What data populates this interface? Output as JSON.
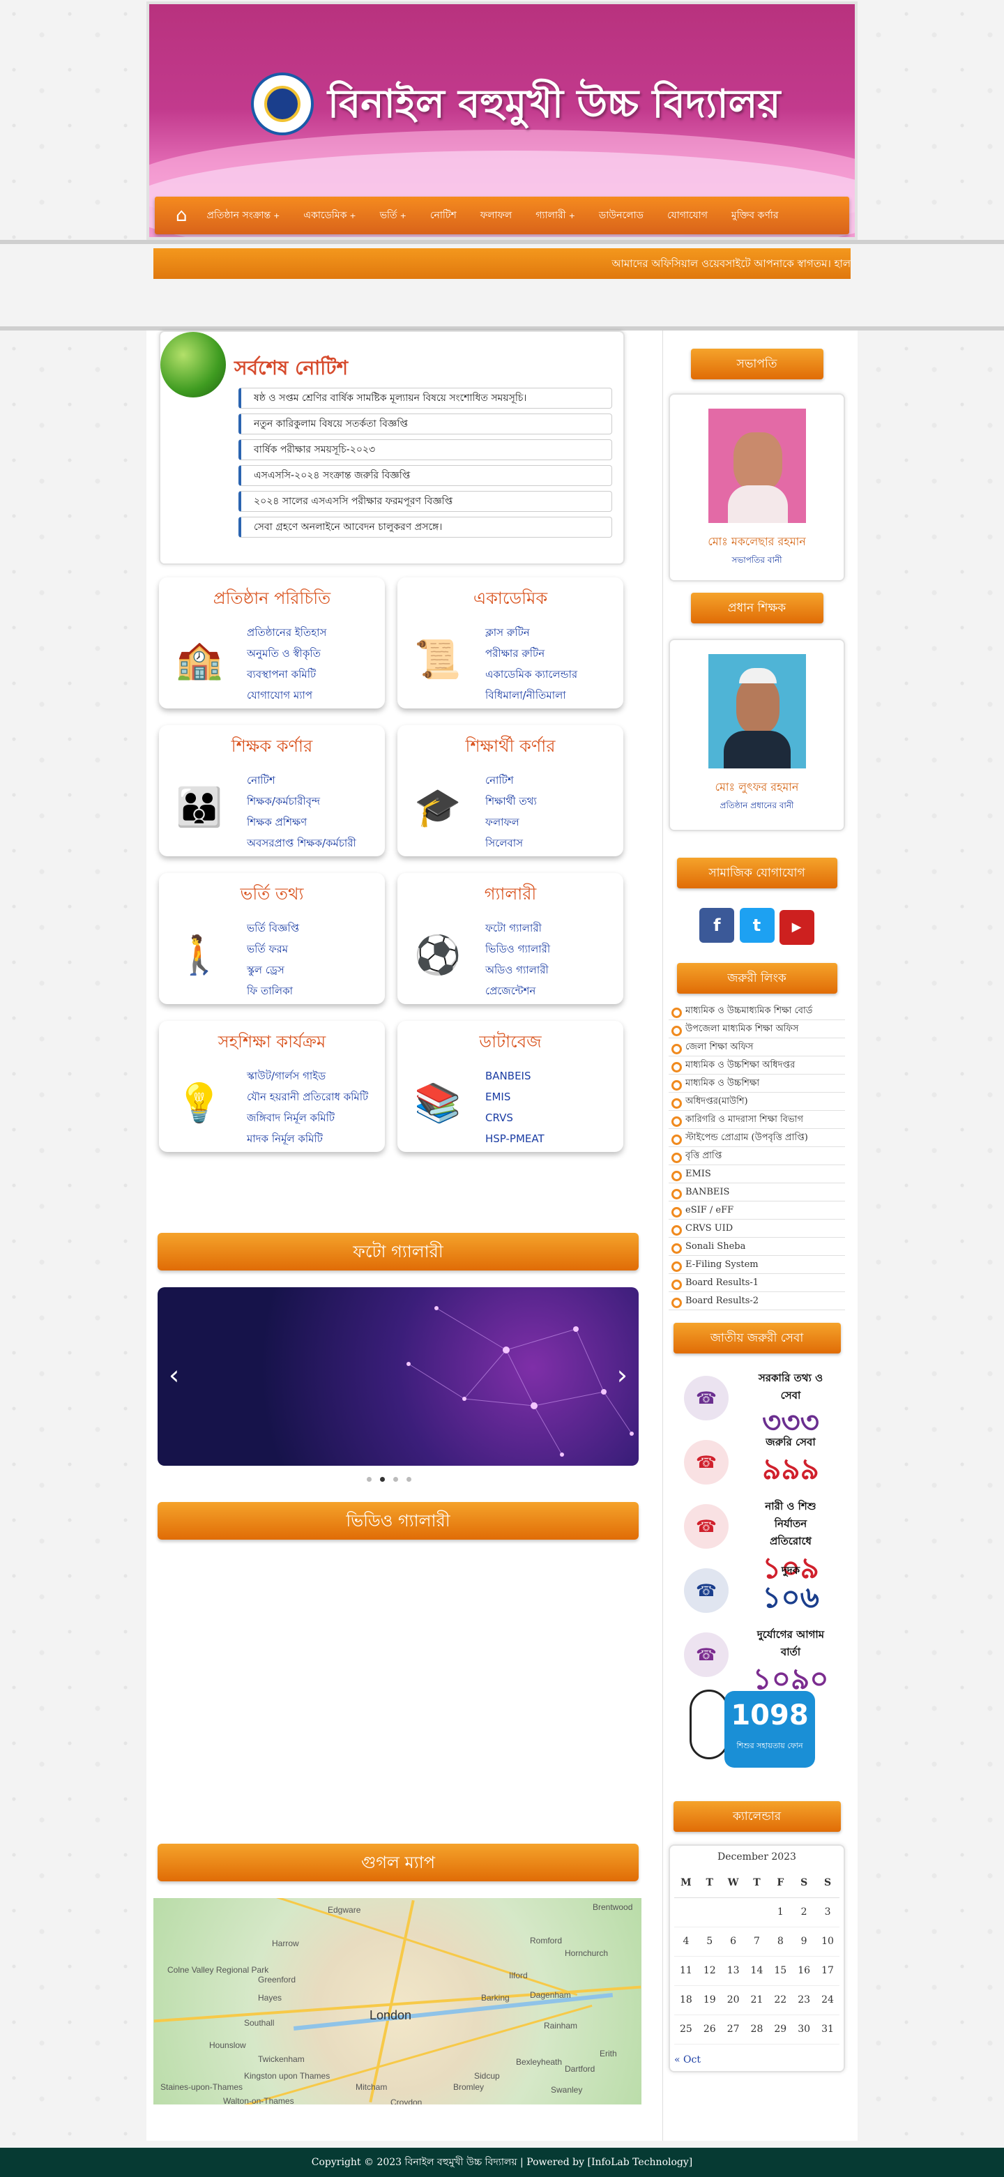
{
  "site": {
    "title": "বিনাইল বহুমুখী উচ্চ বিদ্যালয়"
  },
  "nav": {
    "items": [
      {
        "label": "প্রতিষ্ঠান সংক্রান্ত",
        "dropdown": true
      },
      {
        "label": "একাডেমিক",
        "dropdown": true
      },
      {
        "label": "ভর্তি",
        "dropdown": true
      },
      {
        "label": "নোটিশ",
        "dropdown": false
      },
      {
        "label": "ফলাফল",
        "dropdown": false
      },
      {
        "label": "গ্যালারী",
        "dropdown": true
      },
      {
        "label": "ডাউনলোড",
        "dropdown": false
      },
      {
        "label": "যোগাযোগ",
        "dropdown": false
      },
      {
        "label": "মুক্তিব কর্ণার",
        "dropdown": false
      }
    ]
  },
  "marquee": {
    "text": "আমাদের অফিসিয়াল ওয়েবসাইটে আপনাকে স্বাগতম। হাল"
  },
  "notices": {
    "title": "সর্বশেষ নোটিশ",
    "items": [
      "ষষ্ঠ ও সপ্তম শ্রেণির বার্ষিক সামষ্টিক মূল্যায়ন বিষয়ে সংশোধিত সময়সূচি।",
      "নতুন কারিকুলাম বিষয়ে সতর্কতা বিজ্ঞপ্তি",
      "বার্ষিক পরীক্ষার সময়সূচি-২০২৩",
      "এসএসসি-২০২৪ সংক্রান্ত জরুরি বিজ্ঞপ্তি",
      "২০২৪ সালের এসএসসি পরীক্ষার ফরমপূরণ বিজ্ঞপ্তি",
      "সেবা গ্রহণে অনলাইনে আবেদন চালুকরণ প্রসঙ্গে।"
    ]
  },
  "cards": [
    {
      "title": "প্রতিষ্ঠান পরিচিতি",
      "icon": "school-building-icon",
      "links": [
        "প্রতিষ্ঠানের ইতিহাস",
        "অনুমতি ও স্বীকৃতি",
        "ব্যবস্থাপনা কমিটি",
        "যোগাযোগ ম্যাপ"
      ]
    },
    {
      "title": "একাডেমিক",
      "icon": "certificate-icon",
      "links": [
        "ক্লাস রুটিন",
        "পরীক্ষার রুটিন",
        "একাডেমিক ক্যালেন্ডার",
        "বিধিমালা/নীতিমালা"
      ]
    },
    {
      "title": "শিক্ষক কর্ণার",
      "icon": "teachers-group-icon",
      "links": [
        "নোটিশ",
        "শিক্ষক/কর্মচারীবৃন্দ",
        "শিক্ষক প্রশিক্ষণ",
        "অবসরপ্রাপ্ত শিক্ষক/কর্মচারী"
      ]
    },
    {
      "title": "শিক্ষার্থী কর্ণার",
      "icon": "graduate-icon",
      "links": [
        "নোটিশ",
        "শিক্ষার্থী তথ্য",
        "ফলাফল",
        "সিলেবাস"
      ]
    },
    {
      "title": "ভর্তি তথ্য",
      "icon": "student-walking-icon",
      "links": [
        "ভর্তি বিজ্ঞপ্তি",
        "ভর্তি ফরম",
        "স্কুল ড্রেস",
        "ফি তালিকা"
      ]
    },
    {
      "title": "গ্যালারী",
      "icon": "sports-balls-icon",
      "links": [
        "ফটো গ্যালারী",
        "ভিডিও গ্যালারী",
        "অডিও গ্যালারী",
        "প্রেজেন্টেশন"
      ]
    },
    {
      "title": "সহশিক্ষা কার্যক্রম",
      "icon": "lightbulb-gear-icon",
      "links": [
        "স্কাউট/গার্লস গাইড",
        "যৌন হয়রানী প্রতিরোধ কমিটি",
        "জঙ্গিবাদ নির্মূল কমিটি",
        "মাদক নির্মূল কমিটি"
      ]
    },
    {
      "title": "ডাটাবেজ",
      "icon": "database-books-icon",
      "links": [
        "BANBEIS",
        "EMIS",
        "CRVS",
        "HSP-PMEAT"
      ]
    }
  ],
  "sections": {
    "photo_gallery": "ফটো গ্যালারী",
    "video_gallery": "ভিডিও গ্যালারী",
    "google_map": "গুগল ম্যাপ"
  },
  "map": {
    "labels": [
      "Edgware",
      "Brentwood",
      "Harrow",
      "Romford",
      "Hornchurch",
      "Colne Valley Regional Park",
      "Greenford",
      "Ilford",
      "Barking",
      "Dagenham",
      "Hayes",
      "Southall",
      "London",
      "Rainham",
      "Hounslow",
      "Twickenham",
      "Erith",
      "Bexleyheath",
      "Dartford",
      "Kingston upon Thames",
      "Sidcup",
      "Staines-upon-Thames",
      "Mitcham",
      "Bromley",
      "Swanley",
      "Walton-on-Thames",
      "Croydon"
    ]
  },
  "sidebar": {
    "chairman": {
      "header": "সভাপতি",
      "name": "মোঃ মকলেছার রহমান",
      "role": "সভাপতির বানী"
    },
    "headmaster": {
      "header": "প্রধান শিক্ষক",
      "name": "মোঃ লুৎফর রহমান",
      "role": "প্রতিষ্ঠান প্রধানের বানী"
    },
    "social": {
      "header": "সামাজিক যোগাযোগ",
      "facebook": "f",
      "twitter": "t",
      "youtube": "▶"
    },
    "links": {
      "header": "জরুরী লিংক",
      "items": [
        "মাধ্যমিক ও উচ্চমাধ্যমিক শিক্ষা বোর্ড",
        "উপজেলা মাধ্যমিক শিক্ষা অফিস",
        "জেলা শিক্ষা অফিস",
        "মাধ্যমিক ও উচ্চশিক্ষা অধিদপ্তর",
        "মাধ্যমিক ও উচ্চশিক্ষা",
        "অধিদপ্তর(মাউশি)",
        "কারিগরি ও মাদরাসা শিক্ষা বিভাগ",
        "স্টাইপেন্ড প্রোগ্রাম (উপবৃত্তি প্রাপ্তি)",
        "বৃত্তি প্রাপ্তি",
        "EMIS",
        "BANBEIS",
        "eSIF / eFF",
        "CRVS UID",
        "Sonali Sheba",
        "E-Filing System",
        "Board Results-1",
        "Board Results-2"
      ]
    },
    "emergency": {
      "header": "জাতীয় জরুরী সেবা",
      "items": [
        {
          "small": "সরকারি তথ্য ও সেবা",
          "number": "৩৩৩",
          "color": "#6a2e8f",
          "icon": "phone-333-icon"
        },
        {
          "small": "জরুরি সেবা",
          "number": "৯৯৯",
          "color": "#d0202c",
          "icon": "national-emergency-999-icon"
        },
        {
          "small": "নারী ও শিশু নির্যাতন প্রতিরোধে",
          "number": "১০৯",
          "color": "#d0202c",
          "icon": "helpline-109-icon"
        },
        {
          "small": "দুদক",
          "number": "১০৬",
          "color": "#1a3e8c",
          "icon": "anti-corruption-phone-icon"
        },
        {
          "small": "দুর্যোগের আগাম বার্তা",
          "number": "১০৯০",
          "color": "#7b2c8f",
          "icon": "disaster-warning-icon"
        }
      ],
      "child_helpline": {
        "number": "1098",
        "caption": "শিশুর সহায়তায় ফোন"
      }
    },
    "calendar": {
      "header": "ক্যালেন্ডার",
      "caption": "December 2023",
      "days": [
        "M",
        "T",
        "W",
        "T",
        "F",
        "S",
        "S"
      ],
      "weeks": [
        [
          "",
          "",
          "",
          "",
          "1",
          "2",
          "3"
        ],
        [
          "4",
          "5",
          "6",
          "7",
          "8",
          "9",
          "10"
        ],
        [
          "11",
          "12",
          "13",
          "14",
          "15",
          "16",
          "17"
        ],
        [
          "18",
          "19",
          "20",
          "21",
          "22",
          "23",
          "24"
        ],
        [
          "25",
          "26",
          "27",
          "28",
          "29",
          "30",
          "31"
        ]
      ],
      "prev": "« Oct"
    }
  },
  "footer": {
    "text": "Copyright © 2023 বিনাইল বহুমুখী উচ্চ বিদ্যালয় | Powered by [InfoLab Technology]"
  }
}
